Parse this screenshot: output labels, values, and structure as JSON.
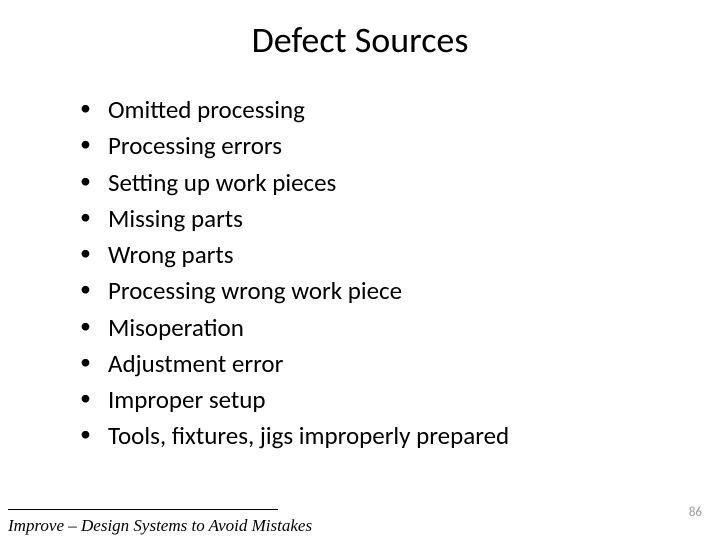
{
  "title": "Defect Sources",
  "bullets": [
    "Omitted processing",
    "Processing errors",
    "Setting up work pieces",
    "Missing parts",
    "Wrong parts",
    "Processing wrong work piece",
    "Misoperation",
    "Adjustment error",
    "Improper setup",
    "Tools, fixtures, jigs improperly prepared"
  ],
  "footer": "Improve – Design Systems to Avoid Mistakes",
  "page_number": "86"
}
